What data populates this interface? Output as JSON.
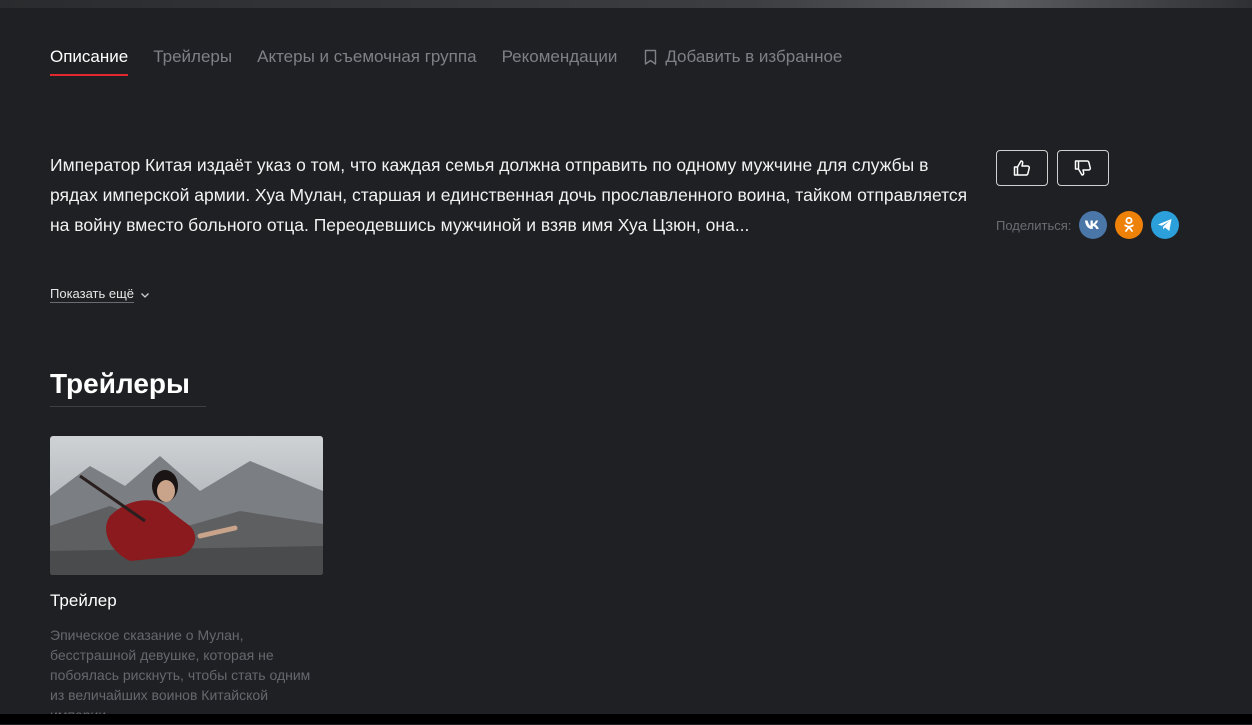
{
  "tabs": {
    "description": "Описание",
    "trailers": "Трейлеры",
    "cast": "Актеры и съемочная группа",
    "recommendations": "Рекомендации",
    "favorite": "Добавить в избранное"
  },
  "synopsis": {
    "text": "Император Китая издаёт указ о том, что каждая семья должна отправить по одному мужчине для службы в рядах имперской армии. Хуа Мулан, старшая и единственная дочь прославленного воина, тайком отправляется на войну вместо больного отца. Переодевшись мужчиной и взяв имя Хуа Цзюн, она...",
    "show_more": "Показать ещё"
  },
  "share": {
    "label": "Поделиться:",
    "icons": [
      "vk-icon",
      "ok-icon",
      "telegram-icon"
    ]
  },
  "rating": {
    "icons": [
      "thumbs-up-icon",
      "thumbs-down-icon"
    ]
  },
  "trailers_section": {
    "title": "Трейлеры",
    "items": [
      {
        "title": "Трейлер",
        "description": "Эпическое сказание о Мулан, бесстрашной девушке, которая не побоялась рискнуть, чтобы стать одним из величайших воинов Китайской империи"
      }
    ]
  },
  "colors": {
    "background": "#1f2023",
    "accent": "#e0282e",
    "muted_text": "#7f8087",
    "vk": "#4a76a8",
    "ok": "#ee8208",
    "telegram": "#2ba0da"
  }
}
